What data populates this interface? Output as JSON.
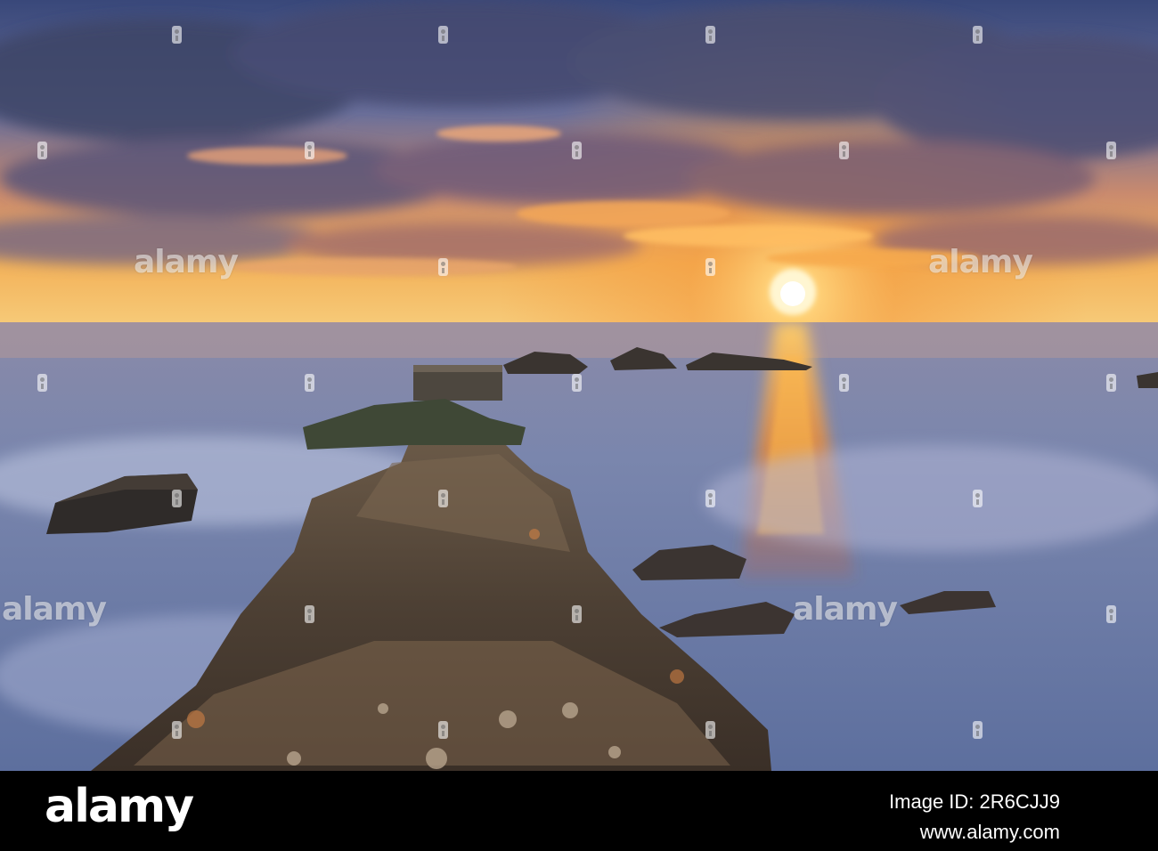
{
  "photo": {
    "subject": "sunset-over-sea-with-stone-breakwater",
    "colors": {
      "sky_top": "#3c4a78",
      "sky_glow": "#f7a53c",
      "sun": "#fff3c4",
      "sea": "#6f7fa6",
      "reflection": "#ff9b2e",
      "rock": "#4a4036"
    }
  },
  "watermark": {
    "word": "alamy"
  },
  "footer": {
    "logo": "alamy",
    "image_id": "Image ID: 2R6CJJ9",
    "url": "www.alamy.com"
  }
}
